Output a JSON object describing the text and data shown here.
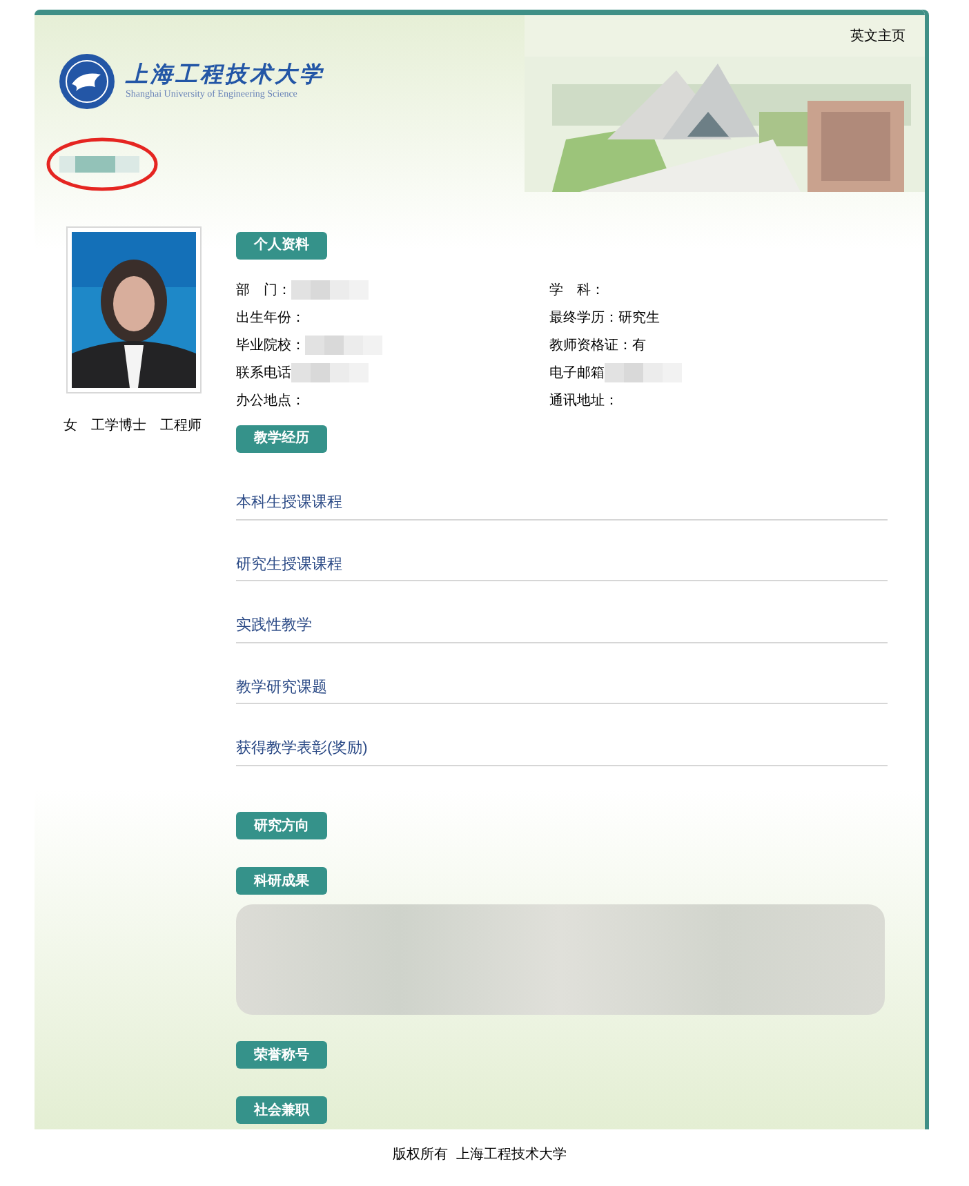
{
  "header": {
    "logo_cn": "上海工程技术大学",
    "logo_en": "Shanghai University of Engineering Science",
    "link": "英文主页"
  },
  "name_annotation": {
    "redacted": true,
    "circled": true
  },
  "profile": {
    "tags": [
      "女",
      "工学博士",
      "工程师"
    ]
  },
  "sections": [
    {
      "kind": "info",
      "title": "个人资料",
      "rows": [
        [
          {
            "label": "部　门：",
            "redacted": true
          },
          {
            "label": "学　科："
          }
        ],
        [
          {
            "label": "出生年份："
          },
          {
            "label": "最终学历：",
            "value": "研究生"
          }
        ],
        [
          {
            "label": "毕业院校：",
            "redacted": true
          },
          {
            "label": "教师资格证：",
            "value": "有"
          }
        ],
        [
          {
            "label": "联系电话",
            "redacted": true
          },
          {
            "label": "电子邮箱",
            "redacted": true
          }
        ],
        [
          {
            "label": "办公地点："
          },
          {
            "label": "通讯地址："
          }
        ]
      ]
    },
    {
      "kind": "button",
      "title": "教学经历"
    },
    {
      "kind": "subheading",
      "title": "本科生授课课程"
    },
    {
      "kind": "subheading",
      "title": "研究生授课课程"
    },
    {
      "kind": "subheading",
      "title": "实践性教学"
    },
    {
      "kind": "subheading",
      "title": "教学研究课题"
    },
    {
      "kind": "subheading",
      "title": "获得教学表彰(奖励)"
    },
    {
      "kind": "button",
      "title": "研究方向"
    },
    {
      "kind": "button",
      "title": "科研成果",
      "redacted_text": true
    },
    {
      "kind": "button",
      "title": "荣誉称号"
    },
    {
      "kind": "button",
      "title": "社会兼职"
    }
  ],
  "footer": "版权所有  上海工程技术大学"
}
